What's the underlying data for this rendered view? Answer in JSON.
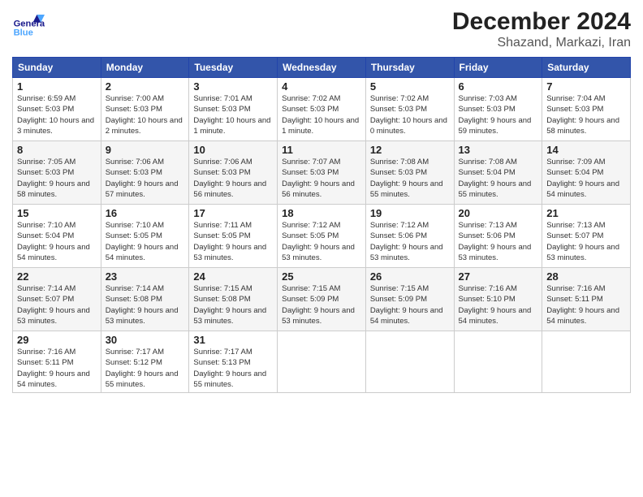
{
  "header": {
    "logo_text": "General Blue",
    "month": "December 2024",
    "location": "Shazand, Markazi, Iran"
  },
  "weekdays": [
    "Sunday",
    "Monday",
    "Tuesday",
    "Wednesday",
    "Thursday",
    "Friday",
    "Saturday"
  ],
  "weeks": [
    [
      {
        "day": "1",
        "sunrise": "6:59 AM",
        "sunset": "5:03 PM",
        "daylight": "10 hours and 3 minutes."
      },
      {
        "day": "2",
        "sunrise": "7:00 AM",
        "sunset": "5:03 PM",
        "daylight": "10 hours and 2 minutes."
      },
      {
        "day": "3",
        "sunrise": "7:01 AM",
        "sunset": "5:03 PM",
        "daylight": "10 hours and 1 minute."
      },
      {
        "day": "4",
        "sunrise": "7:02 AM",
        "sunset": "5:03 PM",
        "daylight": "10 hours and 1 minute."
      },
      {
        "day": "5",
        "sunrise": "7:02 AM",
        "sunset": "5:03 PM",
        "daylight": "10 hours and 0 minutes."
      },
      {
        "day": "6",
        "sunrise": "7:03 AM",
        "sunset": "5:03 PM",
        "daylight": "9 hours and 59 minutes."
      },
      {
        "day": "7",
        "sunrise": "7:04 AM",
        "sunset": "5:03 PM",
        "daylight": "9 hours and 58 minutes."
      }
    ],
    [
      {
        "day": "8",
        "sunrise": "7:05 AM",
        "sunset": "5:03 PM",
        "daylight": "9 hours and 58 minutes."
      },
      {
        "day": "9",
        "sunrise": "7:06 AM",
        "sunset": "5:03 PM",
        "daylight": "9 hours and 57 minutes."
      },
      {
        "day": "10",
        "sunrise": "7:06 AM",
        "sunset": "5:03 PM",
        "daylight": "9 hours and 56 minutes."
      },
      {
        "day": "11",
        "sunrise": "7:07 AM",
        "sunset": "5:03 PM",
        "daylight": "9 hours and 56 minutes."
      },
      {
        "day": "12",
        "sunrise": "7:08 AM",
        "sunset": "5:03 PM",
        "daylight": "9 hours and 55 minutes."
      },
      {
        "day": "13",
        "sunrise": "7:08 AM",
        "sunset": "5:04 PM",
        "daylight": "9 hours and 55 minutes."
      },
      {
        "day": "14",
        "sunrise": "7:09 AM",
        "sunset": "5:04 PM",
        "daylight": "9 hours and 54 minutes."
      }
    ],
    [
      {
        "day": "15",
        "sunrise": "7:10 AM",
        "sunset": "5:04 PM",
        "daylight": "9 hours and 54 minutes."
      },
      {
        "day": "16",
        "sunrise": "7:10 AM",
        "sunset": "5:05 PM",
        "daylight": "9 hours and 54 minutes."
      },
      {
        "day": "17",
        "sunrise": "7:11 AM",
        "sunset": "5:05 PM",
        "daylight": "9 hours and 53 minutes."
      },
      {
        "day": "18",
        "sunrise": "7:12 AM",
        "sunset": "5:05 PM",
        "daylight": "9 hours and 53 minutes."
      },
      {
        "day": "19",
        "sunrise": "7:12 AM",
        "sunset": "5:06 PM",
        "daylight": "9 hours and 53 minutes."
      },
      {
        "day": "20",
        "sunrise": "7:13 AM",
        "sunset": "5:06 PM",
        "daylight": "9 hours and 53 minutes."
      },
      {
        "day": "21",
        "sunrise": "7:13 AM",
        "sunset": "5:07 PM",
        "daylight": "9 hours and 53 minutes."
      }
    ],
    [
      {
        "day": "22",
        "sunrise": "7:14 AM",
        "sunset": "5:07 PM",
        "daylight": "9 hours and 53 minutes."
      },
      {
        "day": "23",
        "sunrise": "7:14 AM",
        "sunset": "5:08 PM",
        "daylight": "9 hours and 53 minutes."
      },
      {
        "day": "24",
        "sunrise": "7:15 AM",
        "sunset": "5:08 PM",
        "daylight": "9 hours and 53 minutes."
      },
      {
        "day": "25",
        "sunrise": "7:15 AM",
        "sunset": "5:09 PM",
        "daylight": "9 hours and 53 minutes."
      },
      {
        "day": "26",
        "sunrise": "7:15 AM",
        "sunset": "5:09 PM",
        "daylight": "9 hours and 54 minutes."
      },
      {
        "day": "27",
        "sunrise": "7:16 AM",
        "sunset": "5:10 PM",
        "daylight": "9 hours and 54 minutes."
      },
      {
        "day": "28",
        "sunrise": "7:16 AM",
        "sunset": "5:11 PM",
        "daylight": "9 hours and 54 minutes."
      }
    ],
    [
      {
        "day": "29",
        "sunrise": "7:16 AM",
        "sunset": "5:11 PM",
        "daylight": "9 hours and 54 minutes."
      },
      {
        "day": "30",
        "sunrise": "7:17 AM",
        "sunset": "5:12 PM",
        "daylight": "9 hours and 55 minutes."
      },
      {
        "day": "31",
        "sunrise": "7:17 AM",
        "sunset": "5:13 PM",
        "daylight": "9 hours and 55 minutes."
      },
      null,
      null,
      null,
      null
    ]
  ],
  "labels": {
    "sunrise": "Sunrise:",
    "sunset": "Sunset:",
    "daylight": "Daylight:"
  }
}
